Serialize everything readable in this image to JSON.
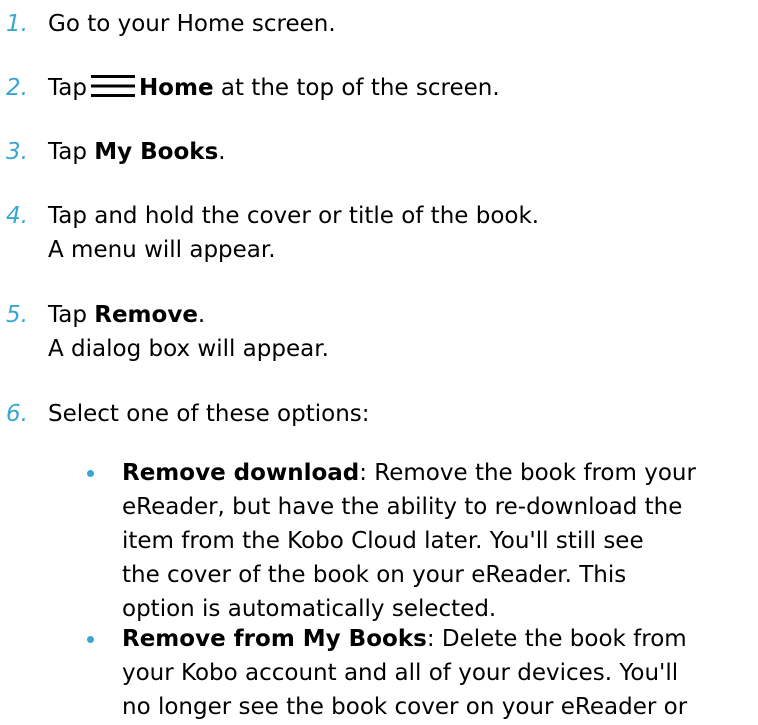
{
  "steps": [
    {
      "num": "1.",
      "text": "Go to your Home screen."
    },
    {
      "num": "2.",
      "pre": "Tap",
      "icon": "hamburger-menu-icon",
      "bold": "Home",
      "post": " at the top of the screen."
    },
    {
      "num": "3.",
      "pre": "Tap ",
      "bold": "My Books",
      "post": "."
    },
    {
      "num": "4.",
      "line1": "Tap and hold the cover or title of the book.",
      "line2": "A menu will appear."
    },
    {
      "num": "5.",
      "pre": "Tap ",
      "bold": "Remove",
      "post": ".",
      "line2": "A dialog box will appear."
    },
    {
      "num": "6.",
      "text": "Select one of these options:"
    }
  ],
  "options": [
    {
      "bold": "Remove download",
      "rest": ": Remove the book from your",
      "lines": [
        "eReader, but have the ability to re-download the",
        "item from the Kobo Cloud later. You'll still see",
        "the cover of the book on your eReader. This",
        "option is automatically selected."
      ]
    },
    {
      "bold": "Remove from My Books",
      "rest": ": Delete the book from",
      "lines": [
        "your Kobo account and all of your devices. You'll",
        "no longer see the book cover on your eReader or"
      ]
    }
  ],
  "colors": {
    "accent": "#3aa7d3",
    "text": "#000000"
  }
}
